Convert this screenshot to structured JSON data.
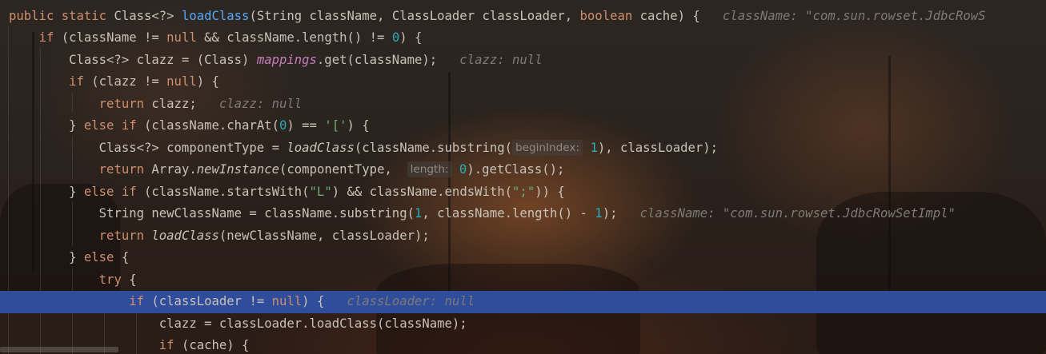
{
  "editor": {
    "lines": [
      [
        {
          "t": "public static ",
          "c": "kw"
        },
        {
          "t": "Class<?> ",
          "c": "plain"
        },
        {
          "t": "loadClass",
          "c": "fn-decl"
        },
        {
          "t": "(String className, ClassLoader classLoader, ",
          "c": "plain"
        },
        {
          "t": "boolean ",
          "c": "kw"
        },
        {
          "t": "cache) {",
          "c": "plain"
        },
        {
          "t": "   className: \"com.sun.rowset.JdbcRowS",
          "c": "hint"
        }
      ],
      [
        {
          "t": "    ",
          "c": "plain"
        },
        {
          "t": "if ",
          "c": "kw"
        },
        {
          "t": "(className != ",
          "c": "plain"
        },
        {
          "t": "null ",
          "c": "kw"
        },
        {
          "t": "&& className.length() != ",
          "c": "plain"
        },
        {
          "t": "0",
          "c": "num"
        },
        {
          "t": ") {",
          "c": "plain"
        }
      ],
      [
        {
          "t": "        Class<?> clazz = (Class) ",
          "c": "plain"
        },
        {
          "t": "mappings",
          "c": "field"
        },
        {
          "t": ".get(className);",
          "c": "plain"
        },
        {
          "t": "   clazz: null",
          "c": "hint"
        }
      ],
      [
        {
          "t": "        ",
          "c": "plain"
        },
        {
          "t": "if ",
          "c": "kw"
        },
        {
          "t": "(clazz != ",
          "c": "plain"
        },
        {
          "t": "null",
          "c": "kw"
        },
        {
          "t": ") {",
          "c": "plain"
        }
      ],
      [
        {
          "t": "            ",
          "c": "plain"
        },
        {
          "t": "return ",
          "c": "kw"
        },
        {
          "t": "clazz;",
          "c": "plain"
        },
        {
          "t": "   clazz: null",
          "c": "hint"
        }
      ],
      [
        {
          "t": "        } ",
          "c": "plain"
        },
        {
          "t": "else if ",
          "c": "kw"
        },
        {
          "t": "(className.charAt(",
          "c": "plain"
        },
        {
          "t": "0",
          "c": "num"
        },
        {
          "t": ") == ",
          "c": "plain"
        },
        {
          "t": "'['",
          "c": "str"
        },
        {
          "t": ") {",
          "c": "plain"
        }
      ],
      [
        {
          "t": "            Class<?> componentType = ",
          "c": "plain"
        },
        {
          "t": "loadClass",
          "c": "static-call"
        },
        {
          "t": "(className.substring(",
          "c": "plain"
        },
        {
          "t": "beginIndex:",
          "c": "param-hint"
        },
        {
          "t": " 1",
          "c": "num"
        },
        {
          "t": "), classLoader);",
          "c": "plain"
        }
      ],
      [
        {
          "t": "            ",
          "c": "plain"
        },
        {
          "t": "return ",
          "c": "kw"
        },
        {
          "t": "Array.",
          "c": "plain"
        },
        {
          "t": "newInstance",
          "c": "static-call"
        },
        {
          "t": "(componentType,  ",
          "c": "plain"
        },
        {
          "t": "length:",
          "c": "param-hint"
        },
        {
          "t": " 0",
          "c": "num"
        },
        {
          "t": ").getClass();",
          "c": "plain"
        }
      ],
      [
        {
          "t": "        } ",
          "c": "plain"
        },
        {
          "t": "else if ",
          "c": "kw"
        },
        {
          "t": "(className.startsWith(",
          "c": "plain"
        },
        {
          "t": "\"L\"",
          "c": "str"
        },
        {
          "t": ") && className.endsWith(",
          "c": "plain"
        },
        {
          "t": "\";\"",
          "c": "str"
        },
        {
          "t": ")) {",
          "c": "plain"
        }
      ],
      [
        {
          "t": "            String newClassName = className.substring(",
          "c": "plain"
        },
        {
          "t": "1",
          "c": "num"
        },
        {
          "t": ", className.length() - ",
          "c": "plain"
        },
        {
          "t": "1",
          "c": "num"
        },
        {
          "t": ");",
          "c": "plain"
        },
        {
          "t": "   className: \"com.sun.rowset.JdbcRowSetImpl\"",
          "c": "hint"
        }
      ],
      [
        {
          "t": "            ",
          "c": "plain"
        },
        {
          "t": "return ",
          "c": "kw"
        },
        {
          "t": "loadClass",
          "c": "static-call"
        },
        {
          "t": "(newClassName, classLoader);",
          "c": "plain"
        }
      ],
      [
        {
          "t": "        } ",
          "c": "plain"
        },
        {
          "t": "else ",
          "c": "kw"
        },
        {
          "t": "{",
          "c": "plain"
        }
      ],
      [
        {
          "t": "            ",
          "c": "plain"
        },
        {
          "t": "try ",
          "c": "kw"
        },
        {
          "t": "{",
          "c": "plain"
        }
      ],
      [
        {
          "t": "                ",
          "c": "plain"
        },
        {
          "t": "if ",
          "c": "kw"
        },
        {
          "t": "(classLoader != ",
          "c": "plain"
        },
        {
          "t": "null",
          "c": "kw"
        },
        {
          "t": ") {",
          "c": "plain"
        },
        {
          "t": "   classLoader: null",
          "c": "hint"
        }
      ],
      [
        {
          "t": "                    clazz = classLoader.loadClass(className);",
          "c": "plain"
        }
      ],
      [
        {
          "t": "                    ",
          "c": "plain"
        },
        {
          "t": "if ",
          "c": "kw"
        },
        {
          "t": "(cache) {",
          "c": "plain"
        }
      ]
    ],
    "highlighted_line": 13,
    "colors": {
      "keyword": "#cf8e6d",
      "method_declaration": "#56a8f5",
      "field": "#c77dbb",
      "number": "#2aacb8",
      "string": "#6aab73",
      "text": "#c8c2b8",
      "inline_hint": "#7d7a77",
      "execution_line": "#2f4d9a"
    }
  }
}
